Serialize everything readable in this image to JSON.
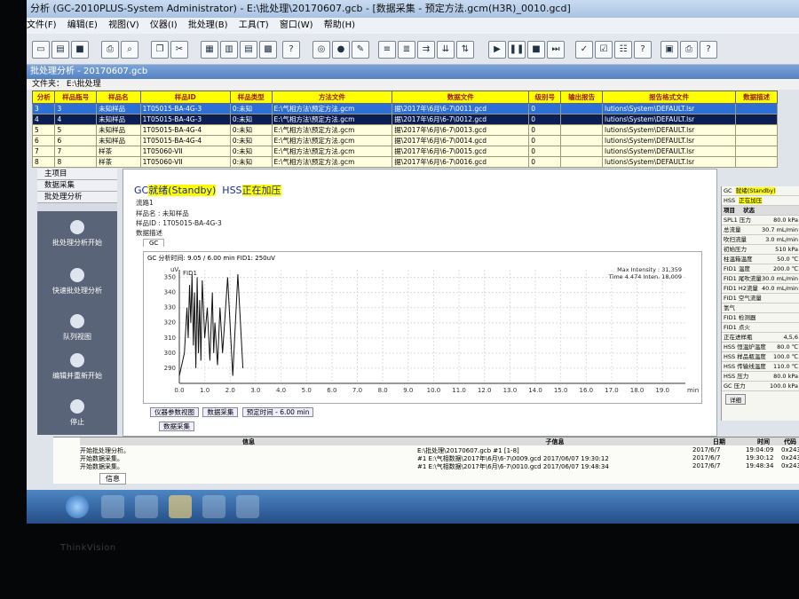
{
  "window": {
    "title": "分析 (GC-2010PLUS-System Administrator) - E:\\批处理\\20170607.gcb - [数据采集 - 预定方法.gcm(H3R)_0010.gcd]"
  },
  "menu": [
    "文件(F)",
    "编辑(E)",
    "视图(V)",
    "仪器(I)",
    "批处理(B)",
    "工具(T)",
    "窗口(W)",
    "帮助(H)"
  ],
  "subwindow": {
    "title": "批处理分析 - 20170607.gcb",
    "file_label": "文件夹：",
    "file_value": "E:\\批处理"
  },
  "batch_table": {
    "headers": [
      "分析",
      "样品瓶号",
      "样品名",
      "样品ID",
      "样品类型",
      "方法文件",
      "数据文件",
      "级别号",
      "输出报告",
      "报告格式文件",
      "数据描述"
    ],
    "rows": [
      [
        "3",
        "3",
        "未知样品",
        "1T05015-BA-4G-3",
        "0:未知",
        "E:\\气相方法\\预定方法.gcm",
        "据\\2017年\\6月\\6-7\\0011.gcd",
        "0",
        "",
        "lutions\\System\\DEFAULT.lsr",
        ""
      ],
      [
        "4",
        "4",
        "未知样品",
        "1T05015-BA-4G-3",
        "0:未知",
        "E:\\气相方法\\预定方法.gcm",
        "据\\2017年\\6月\\6-7\\0012.gcd",
        "0",
        "",
        "lutions\\System\\DEFAULT.lsr",
        ""
      ],
      [
        "5",
        "5",
        "未知样品",
        "1T05015-BA-4G-4",
        "0:未知",
        "E:\\气相方法\\预定方法.gcm",
        "据\\2017年\\6月\\6-7\\0013.gcd",
        "0",
        "",
        "lutions\\System\\DEFAULT.lsr",
        ""
      ],
      [
        "6",
        "6",
        "未知样品",
        "1T05015-BA-4G-4",
        "0:未知",
        "E:\\气相方法\\预定方法.gcm",
        "据\\2017年\\6月\\6-7\\0014.gcd",
        "0",
        "",
        "lutions\\System\\DEFAULT.lsr",
        ""
      ],
      [
        "7",
        "7",
        "样茶",
        "1T05060-VII",
        "0:未知",
        "E:\\气相方法\\预定方法.gcm",
        "据\\2017年\\6月\\6-7\\0015.gcd",
        "0",
        "",
        "lutions\\System\\DEFAULT.lsr",
        ""
      ],
      [
        "8",
        "8",
        "样茶",
        "1T05060-VII",
        "0:未知",
        "E:\\气相方法\\预定方法.gcm",
        "据\\2017年\\6月\\6-7\\0016.gcd",
        "0",
        "",
        "lutions\\System\\DEFAULT.lsr",
        ""
      ]
    ]
  },
  "left_nav": {
    "tabs": [
      "主项目",
      "数据采集",
      "批处理分析"
    ],
    "buttons": [
      "批处理分析开始",
      "快速批处理分析",
      "队列视图",
      "编辑并重新开始",
      "停止"
    ]
  },
  "center": {
    "status_gc": "GC",
    "status_standby": "就绪(Standby)",
    "status_hss": "HSS",
    "status_pressure": "正在加压",
    "flow_label": "流路1",
    "sample_name_label": "样品名",
    "sample_name_value": "未知样品",
    "sample_id_label": "样品ID",
    "sample_id_value": "1T05015-BA-4G-3",
    "data_desc_label": "数据描述",
    "gc_tab": "GC",
    "analysis_time": "GC 分析时间: 9.05 / 6.00 min FID1: 250uV",
    "bottom_tabs": [
      "仪器参数视图",
      "数据采集",
      "预定时间 - 6.00 min"
    ],
    "extra_tab": "数据采集"
  },
  "chart_data": {
    "type": "line",
    "trace_label": "FID1",
    "ylabel": "uV",
    "xlabel": "min",
    "annotation_max": "Max Intensity : 31,359",
    "annotation_time": "Time  4.474  Inten.  18,009",
    "xlim": [
      0,
      19.9
    ],
    "ylim": [
      280,
      355
    ],
    "x_ticks": [
      0,
      1,
      2,
      3,
      4,
      5,
      6,
      7,
      8,
      9,
      10,
      11,
      12,
      13,
      14,
      15,
      16,
      17,
      18,
      19
    ],
    "y_ticks": [
      290,
      300,
      310,
      320,
      330,
      340,
      350
    ],
    "x": [
      0,
      0.2,
      0.3,
      0.35,
      0.4,
      0.45,
      0.5,
      0.55,
      0.6,
      0.65,
      0.7,
      0.75,
      0.8,
      0.85,
      0.9,
      1.0,
      1.1,
      1.2,
      1.3,
      1.35,
      1.4,
      1.5,
      1.6,
      1.7,
      1.9,
      2.1,
      2.3,
      2.5
    ],
    "y": [
      285,
      300,
      330,
      310,
      345,
      320,
      352,
      305,
      340,
      290,
      350,
      300,
      335,
      295,
      348,
      310,
      330,
      295,
      340,
      300,
      320,
      292,
      330,
      300,
      350,
      285,
      352,
      290
    ]
  },
  "right_panel": {
    "gc": "GC",
    "gc_state": "就绪(Standby)",
    "hss": "HSS",
    "hss_state": "正在加压",
    "hdr_item": "项目",
    "hdr_state": "状态",
    "rows": [
      [
        "SPL1 压力",
        "80.0 kPa"
      ],
      [
        "总流量",
        "30.7 mL/min"
      ],
      [
        "吹扫流量",
        "3.0 mL/min"
      ],
      [
        "初始压力",
        "510 kPa"
      ],
      [
        "柱温箱温度",
        "50.0 ℃"
      ],
      [
        "FID1 温度",
        "200.0 ℃"
      ],
      [
        "FID1 尾吹流量",
        "30.0 mL/min"
      ],
      [
        "FID1 H2流量",
        "40.0 mL/min"
      ],
      [
        "FID1 空气流量",
        "300.0 mL/min"
      ],
      [
        "氢气",
        ""
      ],
      [
        "FID1 检测器",
        ""
      ],
      [
        "FID1 点火",
        ""
      ],
      [
        "正在进样瓶",
        "4,5,6"
      ],
      [
        "HSS 恒温炉温度",
        "80.0 ℃"
      ],
      [
        "HSS 样品瓶温度",
        "100.0 ℃"
      ],
      [
        "HSS 传输线温度",
        "110.0 ℃"
      ],
      [
        "HSS 压力",
        "80.0 kPa"
      ],
      [
        "GC 压力",
        "100.0 kPa"
      ]
    ],
    "more_btn": "详细"
  },
  "log": {
    "headers": [
      "信息",
      "子信息",
      "日期",
      "时间",
      "代码"
    ],
    "rows": [
      [
        "开始批处理分析。",
        "E:\\批处理\\20170607.gcb  #1 [1-8]",
        "2017/6/7",
        "19:04:09",
        "0x243a"
      ],
      [
        "开始数据采集。",
        "#1 E:\\气相数据\\2017年\\6月\\6-7\\0009.gcd 2017/06/07 19:30:12",
        "2017/6/7",
        "19:30:12",
        "0x243a"
      ],
      [
        "开始数据采集。",
        "#1 E:\\气相数据\\2017年\\6月\\6-7\\0010.gcd 2017/06/07 19:48:34",
        "2017/6/7",
        "19:48:34",
        "0x243a"
      ]
    ],
    "tab": "信息"
  },
  "taskbar": {
    "clock_time": "",
    "clock_date": ""
  },
  "monitor_brand": "ThinkVision"
}
